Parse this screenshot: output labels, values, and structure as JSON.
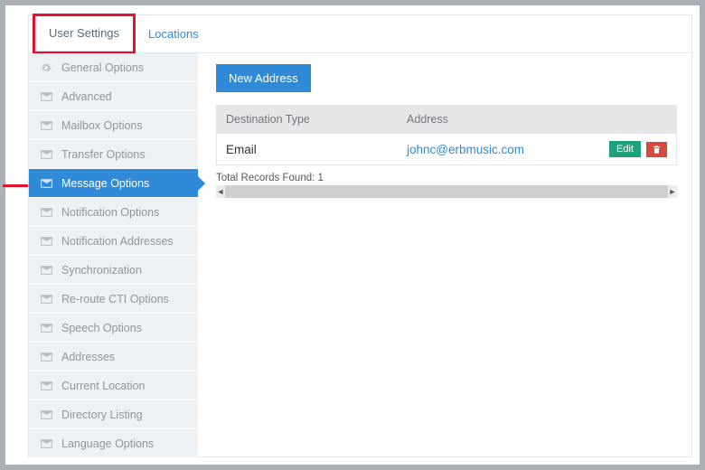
{
  "tabs": {
    "user_settings": "User Settings",
    "locations": "Locations"
  },
  "sidebar": {
    "items": [
      {
        "icon": "gear",
        "label": "General Options"
      },
      {
        "icon": "mail",
        "label": "Advanced"
      },
      {
        "icon": "mail",
        "label": "Mailbox Options"
      },
      {
        "icon": "mail",
        "label": "Transfer Options"
      },
      {
        "icon": "mail",
        "label": "Message Options"
      },
      {
        "icon": "mail",
        "label": "Notification Options"
      },
      {
        "icon": "mail",
        "label": "Notification Addresses"
      },
      {
        "icon": "mail",
        "label": "Synchronization"
      },
      {
        "icon": "mail",
        "label": "Re-route CTI Options"
      },
      {
        "icon": "mail",
        "label": "Speech Options"
      },
      {
        "icon": "mail",
        "label": "Addresses"
      },
      {
        "icon": "mail",
        "label": "Current Location"
      },
      {
        "icon": "mail",
        "label": "Directory Listing"
      },
      {
        "icon": "mail",
        "label": "Language Options"
      }
    ],
    "active_index": 4
  },
  "main": {
    "new_button": "New Address",
    "columns": {
      "dest": "Destination Type",
      "addr": "Address"
    },
    "rows": [
      {
        "dest_type": "Email",
        "address": "johnc@erbmusic.com",
        "edit_label": "Edit"
      }
    ],
    "records_text": "Total Records Found: 1"
  }
}
